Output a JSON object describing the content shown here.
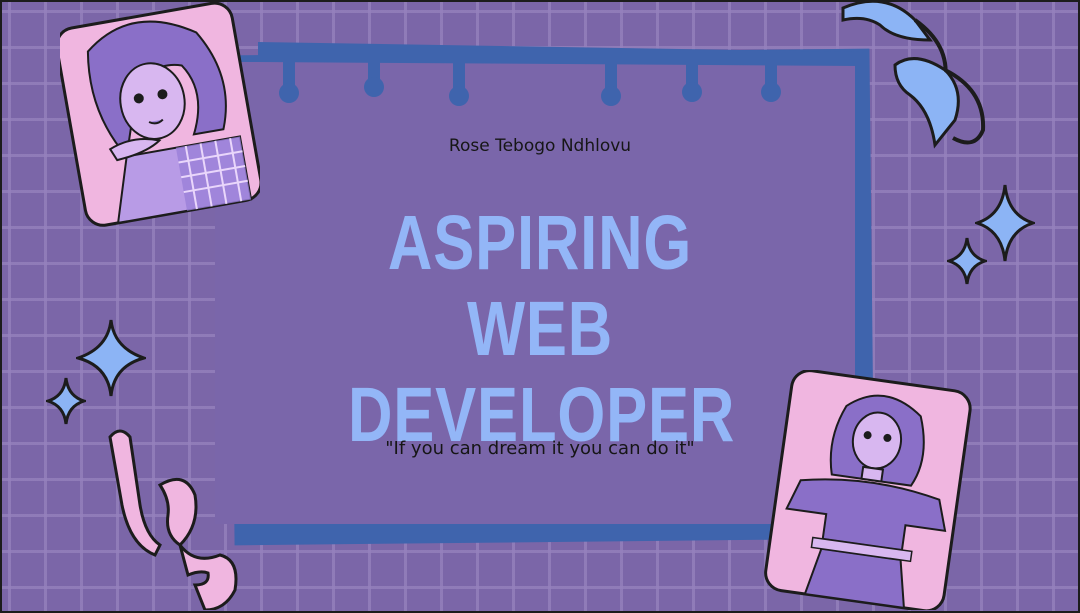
{
  "profile": {
    "name": "Rose Tebogo Ndhlovu",
    "headline_line1": "ASPIRING WEB",
    "headline_line2": "DEVELOPER",
    "quote": "\"If you can dream it you can do it\""
  },
  "colors": {
    "background": "#7b66a8",
    "grid": "#9682be",
    "card": "#7a66aa",
    "card_shadow": "#3f64ad",
    "title": "#93b6f7",
    "sparkle": "#8cb4f5",
    "ribbon_blue": "#8cb4f5",
    "ribbon_pink": "#f0b6e0",
    "portrait_bg": "#f0b6e0"
  },
  "decorations": [
    "portrait-top-left-illustration",
    "portrait-bottom-right-illustration",
    "sparkle-icon",
    "ribbon-blue",
    "ribbon-pink",
    "paint-drip-banner"
  ]
}
